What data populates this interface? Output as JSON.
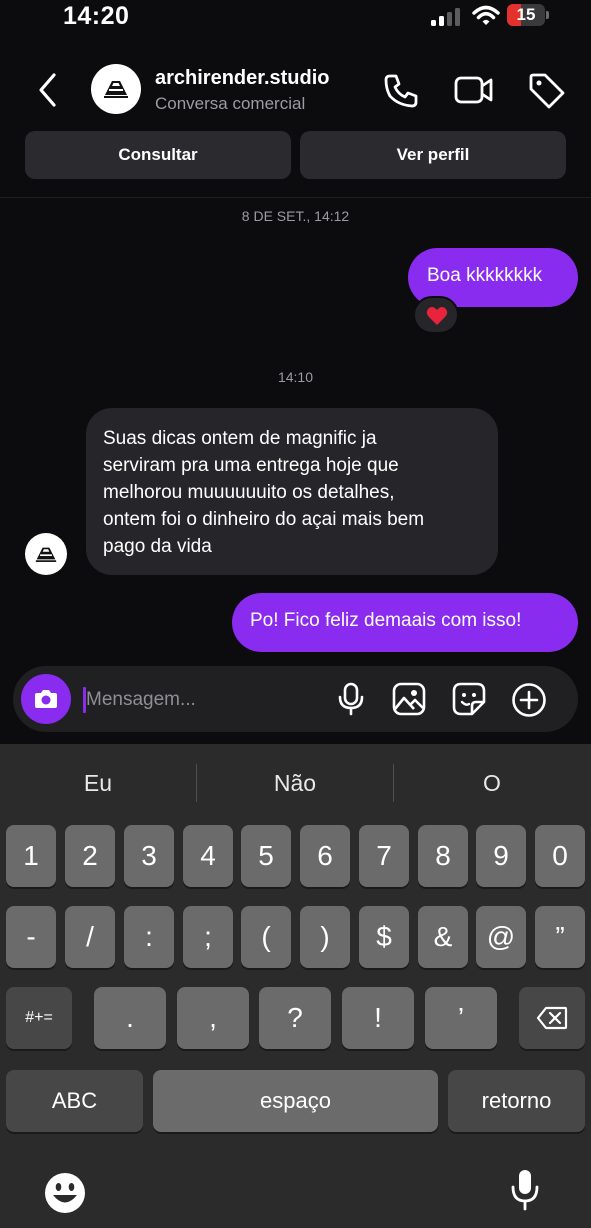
{
  "status": {
    "time": "14:20",
    "battery": "15",
    "battery_level_percent": 15,
    "battery_color": "#e3312e"
  },
  "header": {
    "contact_name": "archirender.studio",
    "subtitle": "Conversa comercial",
    "buttons": {
      "consultar": "Consultar",
      "ver_perfil": "Ver perfil"
    }
  },
  "chat": {
    "timestamp_1": "8 DE SET., 14:12",
    "timestamp_2": "14:10",
    "messages": [
      {
        "from": "me",
        "text": "Boa kkkkkkkk",
        "reaction": "heart"
      },
      {
        "from": "them",
        "lines": [
          "Suas dicas ontem de magnific ja",
          "serviram pra uma entrega hoje que",
          "melhorou muuuuuuito os detalhes,",
          "ontem foi o dinheiro do açai mais bem",
          "pago da vida"
        ]
      },
      {
        "from": "me",
        "text": "Po! Fico feliz demaais com isso!"
      }
    ],
    "accent_color": "#8a2bf0"
  },
  "composer": {
    "placeholder": "Mensagem..."
  },
  "keyboard": {
    "suggestions": [
      "Eu",
      "Não",
      "O"
    ],
    "row1": [
      "1",
      "2",
      "3",
      "4",
      "5",
      "6",
      "7",
      "8",
      "9",
      "0"
    ],
    "row2": [
      "-",
      "/",
      ":",
      ";",
      "(",
      ")",
      "$",
      "&",
      "@",
      "”"
    ],
    "row3": {
      "shift": "#+=",
      "keys": [
        ".",
        ",",
        "?",
        "!",
        "’"
      ]
    },
    "row4": {
      "abc": "ABC",
      "space": "espaço",
      "return": "retorno"
    }
  }
}
